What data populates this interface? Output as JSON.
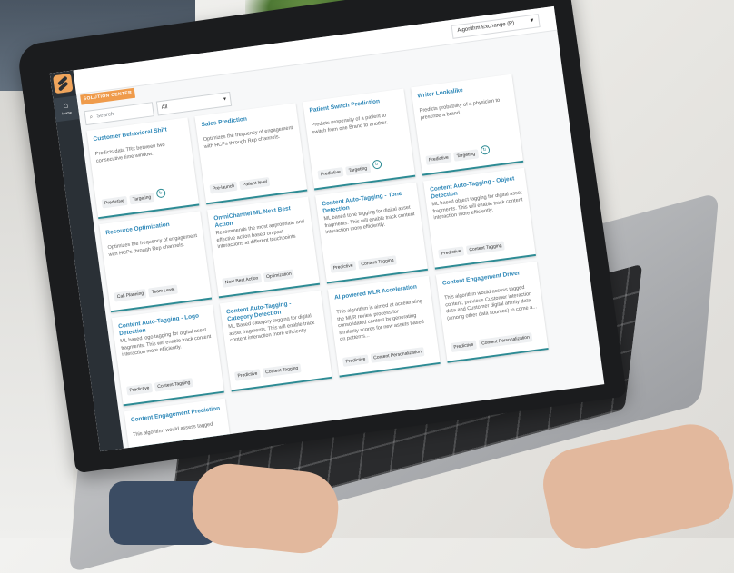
{
  "header": {
    "exchange_label": "Algorithm Exchange (P)"
  },
  "sidebar": {
    "home_label": "Home"
  },
  "section_tab": "SOLUTION CENTER",
  "search": {
    "placeholder": "Search"
  },
  "filter": {
    "selected": "All"
  },
  "cards": [
    {
      "title": "Customer Behavioral Shift",
      "desc": "Predicts data TRx between two consecutive time window.",
      "tags": [
        "Predictive",
        "Targeting"
      ]
    },
    {
      "title": "Sales Prediction",
      "desc": "Optimizes the frequency of engagement with HCPs through Rep channels.",
      "tags": [
        "Pre-launch",
        "Patient level"
      ]
    },
    {
      "title": "Patient Switch Prediction",
      "desc": "Predicts propensity of a patient to switch from one Brand to another.",
      "tags": [
        "Predictive",
        "Targeting"
      ]
    },
    {
      "title": "Writer Lookalike",
      "desc": "Predicts probability of a physician to prescribe a brand.",
      "tags": [
        "Predictive",
        "Targeting"
      ]
    },
    {
      "title": "Resource Optimization",
      "desc": "Optimizes the frequency of engagement with HCPs through Rep channels.",
      "tags": [
        "Call Planning",
        "Team Level"
      ]
    },
    {
      "title": "OmniChannel ML Next Best Action",
      "desc": "Recommends the most appropriate and effective action based on past interactions at different touchpoints",
      "tags": [
        "Next Best Action",
        "Optimization"
      ]
    },
    {
      "title": "Content Auto-Tagging - Tone Detection",
      "desc": "ML based tone tagging for digital asset fragments. This will enable track content interaction more efficiently.",
      "tags": [
        "Predictive",
        "Content Tagging"
      ]
    },
    {
      "title": "Content Auto-Tagging - Object Detection",
      "desc": "ML based object tagging for digital asset fragments. This will enable track content interaction more efficiently.",
      "tags": [
        "Predictive",
        "Content Tagging"
      ]
    },
    {
      "title": "Content Auto-Tagging - Logo Detection",
      "desc": "ML based logo tagging for digital asset fragments. This will enable track content interaction more efficiently.",
      "tags": [
        "Predictive",
        "Content Tagging"
      ]
    },
    {
      "title": "Content Auto-Tagging - Category Detection",
      "desc": "ML Based category tagging for digital asset fragments. This will enable track content interaction more efficiently.",
      "tags": [
        "Predictive",
        "Content Tagging"
      ]
    },
    {
      "title": "AI powered MLR Acceleration",
      "desc": "This algorithm is aimed at accelerating the MLR review process for consolidated content by generating similarity scores for new assets based on patterns...",
      "tags": [
        "Predictive",
        "Content Personalization"
      ]
    },
    {
      "title": "Content Engagement Driver",
      "desc": "This algorithm would assess tagged content, previous Customer interaction data and Customer digital affinity data (among other data sources) to come a...",
      "tags": [
        "Predictive",
        "Content Personalization"
      ]
    },
    {
      "title": "Content Engagement Prediction",
      "desc": "This algorithm would assess tagged",
      "tags": []
    }
  ],
  "colors": {
    "accent": "#ef9b4b",
    "title": "#2e88b8",
    "rule": "#2d8b94",
    "sidebar": "#2a3036"
  }
}
